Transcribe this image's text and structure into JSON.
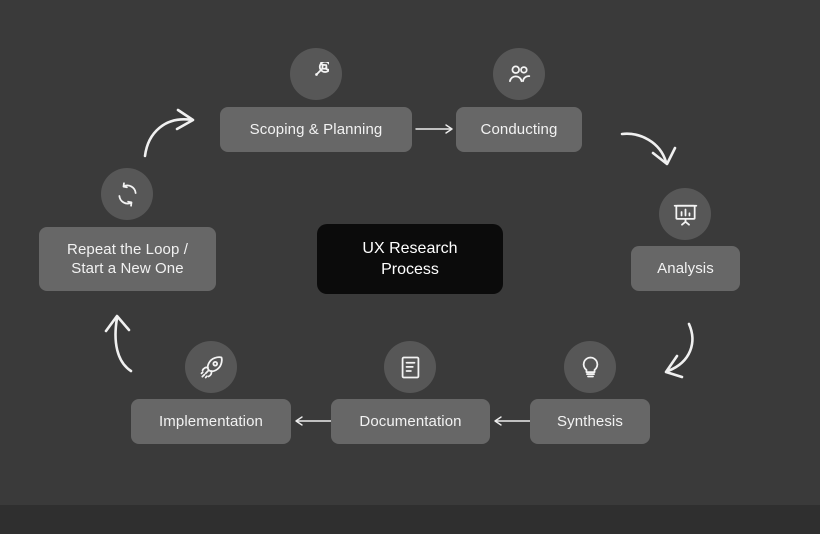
{
  "diagram": {
    "title": "UX Research\nProcess",
    "background_color": "#3a3a3a",
    "node_color": "#676767",
    "center_card_color": "#0b0b0b",
    "icon_bubble_color": "#575757",
    "text_color": "#f2f2f2",
    "steps": [
      {
        "id": "scoping-planning",
        "label": "Scoping & Planning",
        "icon": "target-arrow-icon"
      },
      {
        "id": "conducting",
        "label": "Conducting",
        "icon": "users-icon"
      },
      {
        "id": "analysis",
        "label": "Analysis",
        "icon": "presentation-chart-icon"
      },
      {
        "id": "synthesis",
        "label": "Synthesis",
        "icon": "lightbulb-icon"
      },
      {
        "id": "documentation",
        "label": "Documentation",
        "icon": "document-text-icon"
      },
      {
        "id": "implementation",
        "label": "Implementation",
        "icon": "rocket-icon"
      },
      {
        "id": "repeat-loop",
        "label": "Repeat the Loop /\nStart a New One",
        "icon": "refresh-loop-icon"
      }
    ],
    "connectors": [
      {
        "id": "scoping-to-conducting",
        "kind": "straight-arrow-right"
      },
      {
        "id": "conducting-to-analysis",
        "kind": "curved-arrow-down-right"
      },
      {
        "id": "analysis-to-synthesis",
        "kind": "curved-arrow-down-left"
      },
      {
        "id": "synthesis-to-documentation",
        "kind": "straight-arrow-left"
      },
      {
        "id": "documentation-to-implementation",
        "kind": "straight-arrow-left"
      },
      {
        "id": "implementation-to-repeat",
        "kind": "curved-arrow-up-left"
      },
      {
        "id": "repeat-to-scoping",
        "kind": "curved-arrow-up-right"
      }
    ]
  }
}
